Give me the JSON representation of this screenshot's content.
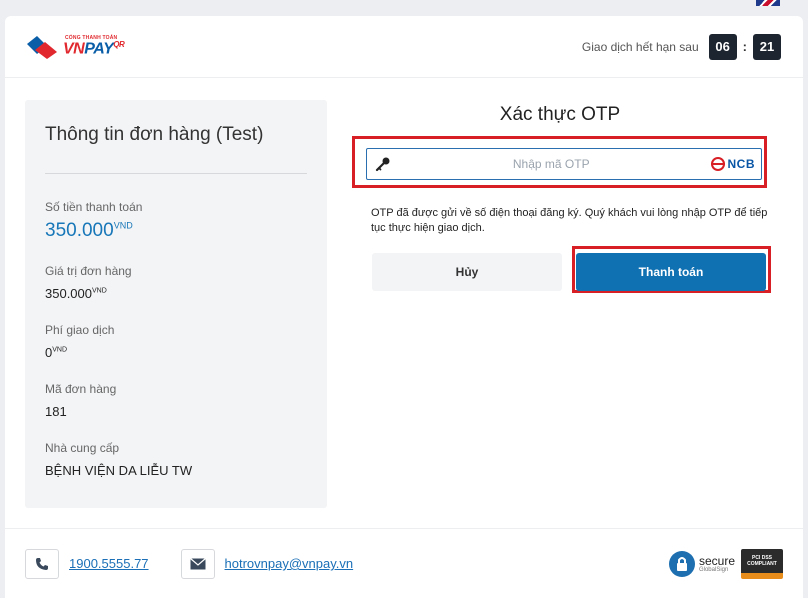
{
  "header": {
    "logo_small": "CỔNG THANH TOÁN",
    "logo_vn": "VN",
    "logo_pay": "PAY",
    "logo_qr": "QR",
    "timer_label": "Giao dịch hết hạn sau",
    "minutes": "06",
    "seconds": "21"
  },
  "order": {
    "title": "Thông tin đơn hàng (Test)",
    "amount_label": "Số tiền thanh toán",
    "amount_value": "350.000",
    "currency": "VND",
    "order_value_label": "Giá trị đơn hàng",
    "order_value": "350.000",
    "fee_label": "Phí giao dịch",
    "fee_value": "0",
    "order_id_label": "Mã đơn hàng",
    "order_id": "181",
    "provider_label": "Nhà cung cấp",
    "provider": "BỆNH VIỆN DA LIỄU TW"
  },
  "otp": {
    "title": "Xác thực OTP",
    "placeholder": "Nhập mã OTP",
    "value": "",
    "bank": "NCB",
    "note": "OTP đã được gửi về số điện thoại đăng ký. Quý khách vui lòng nhập OTP để tiếp tục thực hiện giao dịch.",
    "cancel_label": "Hủy",
    "pay_label": "Thanh toán"
  },
  "footer": {
    "phone": "1900.5555.77",
    "email": "hotrovnpay@vnpay.vn",
    "secure_word": "secure",
    "secure_sub": "GlobalSign",
    "pci_line1": "PCI DSS",
    "pci_line2": "COMPLIANT"
  },
  "colors": {
    "primary": "#0f70b2",
    "highlight": "#d81f26",
    "amount": "#1777b8"
  }
}
